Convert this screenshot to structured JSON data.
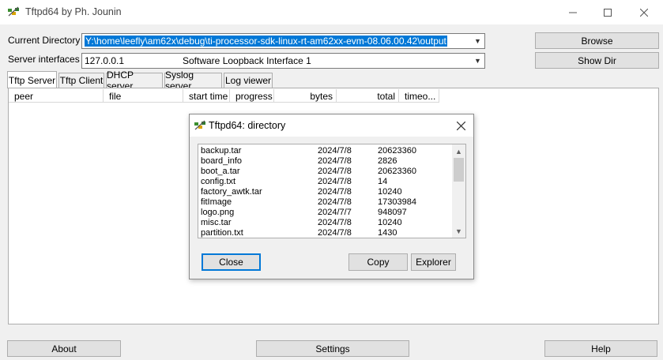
{
  "window": {
    "title": "Tftpd64 by Ph. Jounin"
  },
  "controls": {
    "current_directory_label": "Current Directory",
    "current_directory_value": "Y:\\home\\leefly\\am62x\\debug\\ti-processor-sdk-linux-rt-am62xx-evm-08.06.00.42\\output",
    "server_interfaces_label": "Server interfaces",
    "server_interface_ip": "127.0.0.1",
    "server_interface_name": "Software Loopback Interface 1",
    "browse_label": "Browse",
    "show_dir_label": "Show Dir"
  },
  "tabs": [
    {
      "label": "Tftp Server",
      "active": true
    },
    {
      "label": "Tftp Client"
    },
    {
      "label": "DHCP server"
    },
    {
      "label": "Syslog server"
    },
    {
      "label": "Log viewer"
    }
  ],
  "columns": [
    "peer",
    "file",
    "start time",
    "progress",
    "bytes",
    "total",
    "timeo..."
  ],
  "bottom_buttons": {
    "about": "About",
    "settings": "Settings",
    "help": "Help"
  },
  "dialog": {
    "title": "Tftpd64: directory",
    "files": [
      {
        "name": "backup.tar",
        "date": "2024/7/8",
        "size": "20623360"
      },
      {
        "name": "board_info",
        "date": "2024/7/8",
        "size": "2826"
      },
      {
        "name": "boot_a.tar",
        "date": "2024/7/8",
        "size": "20623360"
      },
      {
        "name": "config.txt",
        "date": "2024/7/8",
        "size": "14"
      },
      {
        "name": "factory_awtk.tar",
        "date": "2024/7/8",
        "size": "10240"
      },
      {
        "name": "fitImage",
        "date": "2024/7/8",
        "size": "17303984"
      },
      {
        "name": "logo.png",
        "date": "2024/7/7",
        "size": "948097"
      },
      {
        "name": "misc.tar",
        "date": "2024/7/8",
        "size": "10240"
      },
      {
        "name": "partition.txt",
        "date": "2024/7/8",
        "size": "1430"
      }
    ],
    "close_label": "Close",
    "copy_label": "Copy",
    "explorer_label": "Explorer"
  },
  "icons": {
    "app": "tftpd-app-icon",
    "minimize": "minimize-icon",
    "maximize": "maximize-icon",
    "close": "close-icon",
    "dropdown": "chevron-down-icon"
  },
  "colors": {
    "selection": "#0078d7",
    "button": "#e1e1e1",
    "window": "#f0f0f0"
  }
}
